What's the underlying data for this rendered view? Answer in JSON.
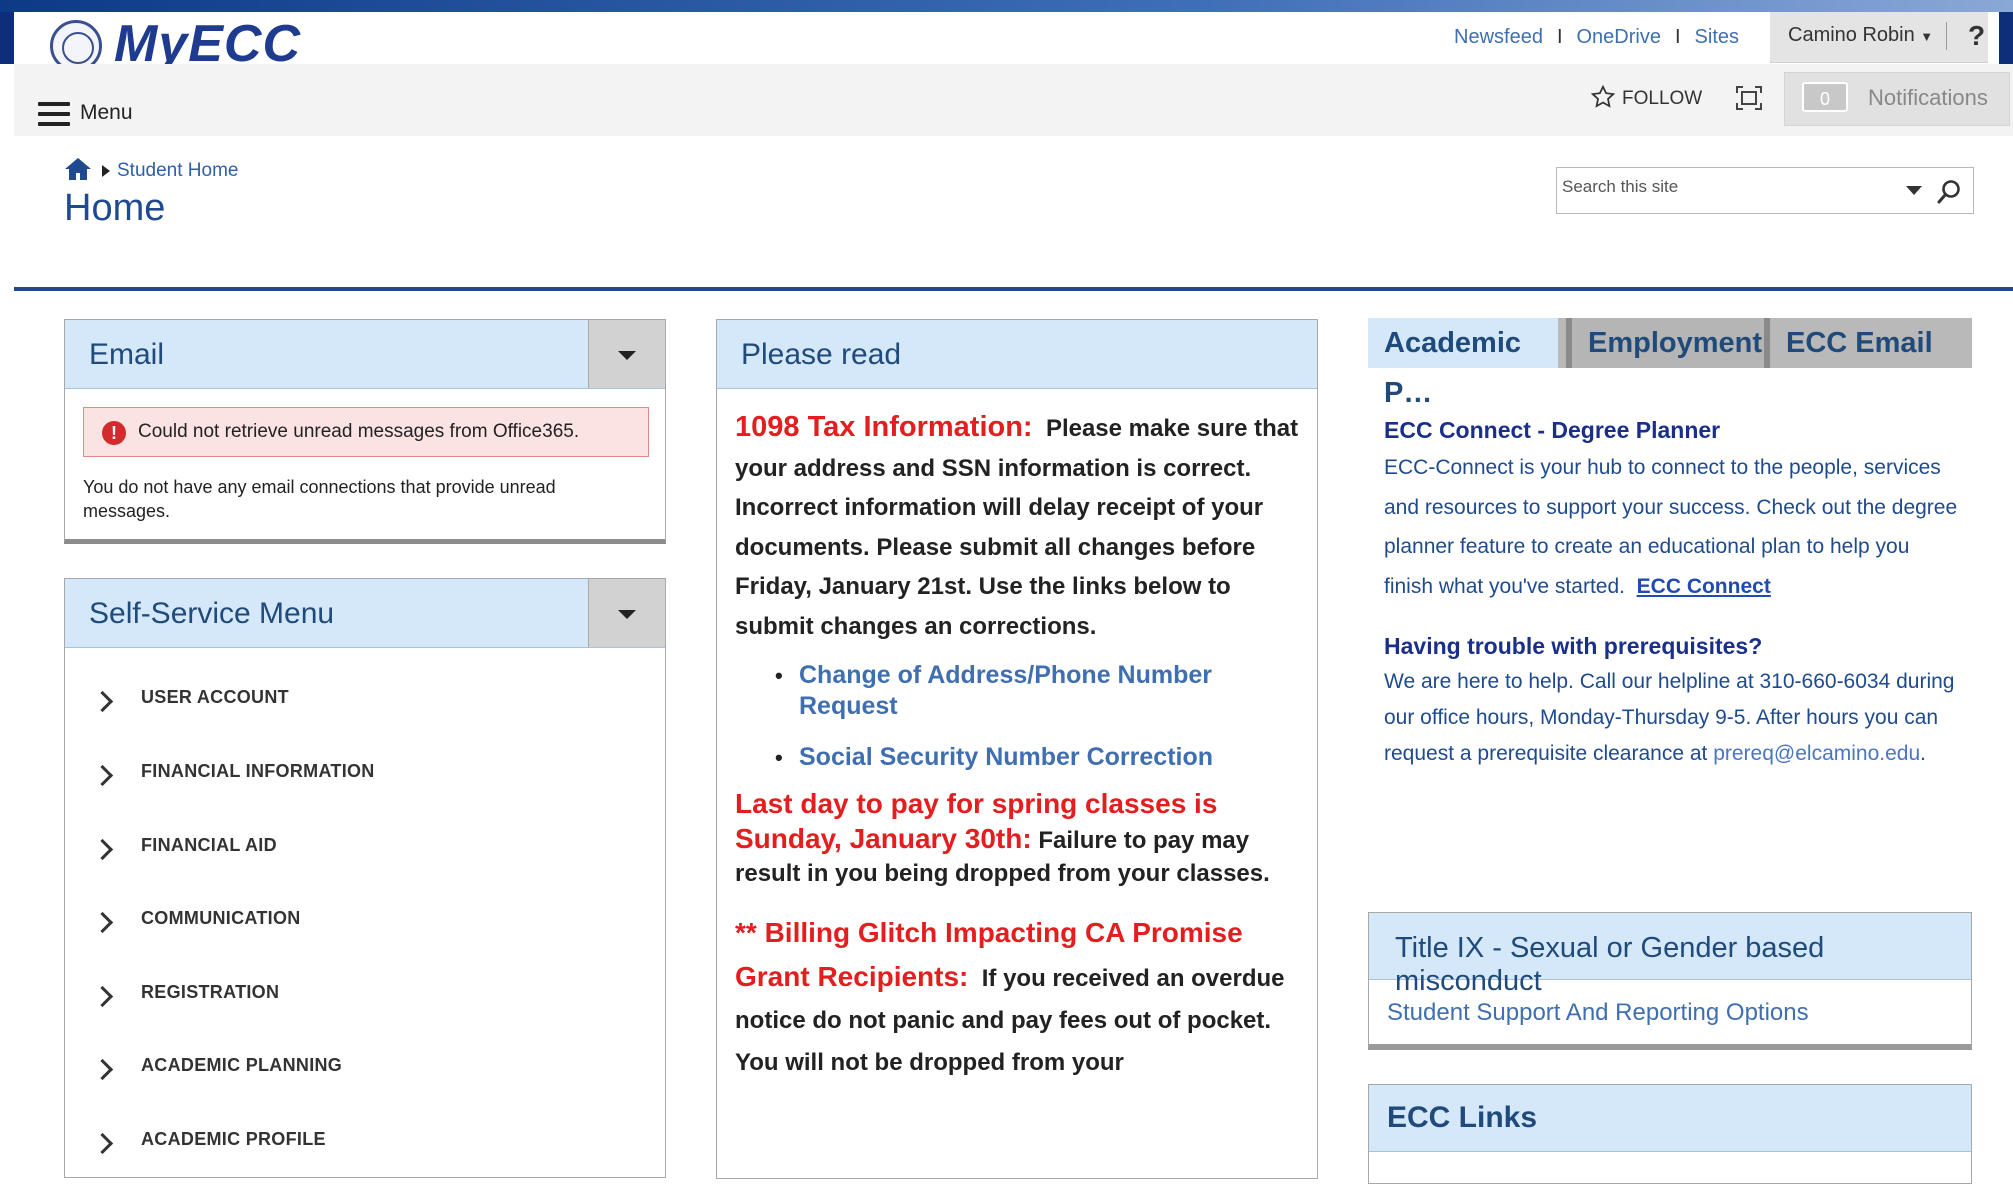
{
  "header": {
    "logo_text": "MyECC",
    "links": [
      "Newsfeed",
      "OneDrive",
      "Sites"
    ],
    "user_name": "Camino Robin",
    "help_label": "?",
    "menu_label": "Menu",
    "follow_label": "FOLLOW",
    "notifications_count": "0",
    "notifications_label": "Notifications"
  },
  "breadcrumb": {
    "item": "Student Home"
  },
  "page_title": "Home",
  "search": {
    "placeholder": "Search this site"
  },
  "email_panel": {
    "title": "Email",
    "error_text": "Could not retrieve unread messages from Office365.",
    "message": "You do not have any email connections that provide unread messages."
  },
  "self_service": {
    "title": "Self-Service Menu",
    "items": [
      "USER ACCOUNT",
      "FINANCIAL INFORMATION",
      "FINANCIAL AID",
      "COMMUNICATION",
      "REGISTRATION",
      "ACADEMIC PLANNING",
      "ACADEMIC PROFILE"
    ]
  },
  "please_read": {
    "title": "Please read",
    "tax_heading": "1098 Tax Information:",
    "tax_text": "Please make sure that your address and SSN information is correct.  Incorrect information will delay receipt of your documents. Please submit all changes before Friday, January 21st. Use the links below to submit changes an corrections.",
    "links": [
      "Change of Address/Phone Number Request",
      "Social Security Number Correction"
    ],
    "pay_heading": "Last day to pay for spring classes is Sunday, January 30th:",
    "pay_text": "Failure to pay may result in you being dropped from your classes.",
    "billing_heading": "** Billing Glitch Impacting CA Promise Grant Recipients:",
    "billing_text": "If you received an overdue notice do not panic and pay fees out of pocket.  You will not be dropped from your"
  },
  "tabs": [
    "Academic P…",
    "Employment",
    "ECC Email"
  ],
  "academic_tab": {
    "heading1": "ECC Connect - Degree Planner",
    "text1": "ECC-Connect is your hub to connect to the people, services and resources to support your success.  Check out the degree planner feature to create an educational plan to help you finish what you've started.",
    "link1": "ECC Connect",
    "heading2": "Having trouble with prerequisites?",
    "text2": "We are here to help.  Call our helpline at 310-660-6034 during our office hours, Monday-Thursday 9-5.  After hours you can request a prerequisite clearance at",
    "email": "prereq@elcamino.edu",
    "email_suffix": "."
  },
  "title_ix": {
    "title": "Title IX - Sexual or Gender based misconduct",
    "link": "Student Support And Reporting Options"
  },
  "ecc_links": {
    "title": "ECC Links"
  },
  "colors": {
    "brand": "#1f3b8f",
    "panel_header": "#d4e8fa",
    "alert_red": "#e41e1e",
    "link": "#3f6fb0"
  }
}
